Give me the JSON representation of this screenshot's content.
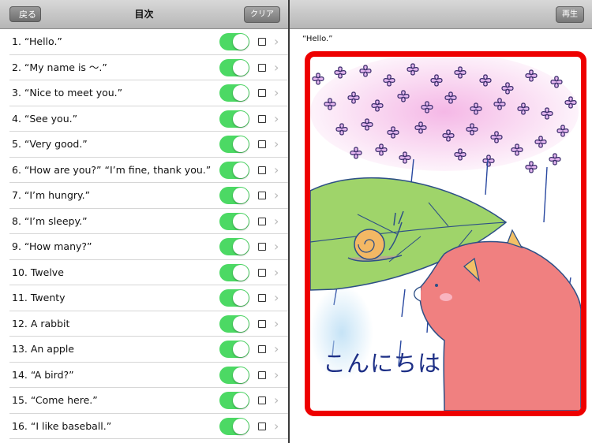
{
  "left_nav": {
    "back_label": "戻る",
    "title": "目次",
    "clear_label": "クリア"
  },
  "items": [
    {
      "label": "1.  “Hello.”",
      "enabled": true
    },
    {
      "label": "2.  “My name is ～.”",
      "enabled": true
    },
    {
      "label": "3.  “Nice to meet you.”",
      "enabled": true
    },
    {
      "label": "4.  “See you.”",
      "enabled": true
    },
    {
      "label": "5.  “Very good.”",
      "enabled": true
    },
    {
      "label": "6.  “How are you?” “I’m fine, thank you.”",
      "enabled": true
    },
    {
      "label": "7.  “I’m hungry.”",
      "enabled": true
    },
    {
      "label": "8.  “I’m sleepy.”",
      "enabled": true
    },
    {
      "label": "9.  “How many?”",
      "enabled": true
    },
    {
      "label": "10.  Twelve",
      "enabled": true
    },
    {
      "label": "11.  Twenty",
      "enabled": true
    },
    {
      "label": "12.  A rabbit",
      "enabled": true
    },
    {
      "label": "13.  An apple",
      "enabled": true
    },
    {
      "label": "14.  “A bird?”",
      "enabled": true
    },
    {
      "label": "15.  “Come here.”",
      "enabled": true
    },
    {
      "label": "16.  “I like baseball.”",
      "enabled": true
    }
  ],
  "right_nav": {
    "play_label": "再生"
  },
  "card": {
    "phrase": "“Hello.”",
    "text": "こんにちは"
  },
  "colors": {
    "toggle_on": "#4cd964",
    "card_border": "#ee0000",
    "card_text": "#1d2f86"
  }
}
